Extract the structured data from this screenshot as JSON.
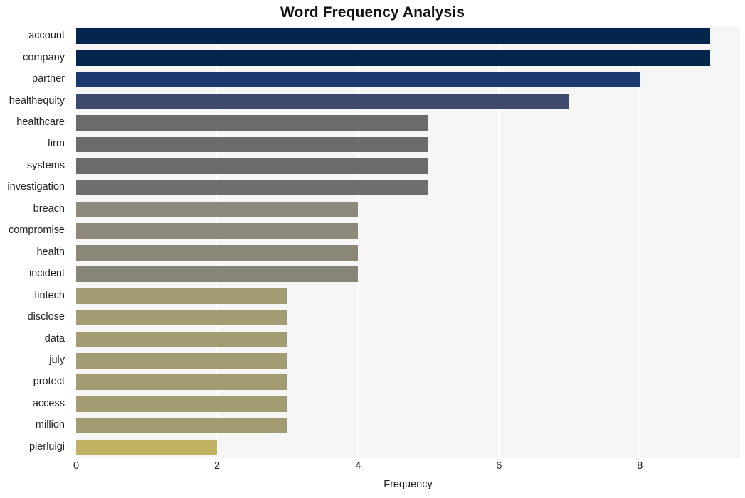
{
  "chart_data": {
    "type": "bar",
    "orientation": "horizontal",
    "title": "Word Frequency Analysis",
    "xlabel": "Frequency",
    "ylabel": "",
    "categories": [
      "account",
      "company",
      "partner",
      "healthequity",
      "healthcare",
      "firm",
      "systems",
      "investigation",
      "breach",
      "compromise",
      "health",
      "incident",
      "fintech",
      "disclose",
      "data",
      "july",
      "protect",
      "access",
      "million",
      "pierluigi"
    ],
    "values": [
      9,
      9,
      8,
      7,
      5,
      5,
      5,
      5,
      4,
      4,
      4,
      4,
      3,
      3,
      3,
      3,
      3,
      3,
      3,
      2
    ],
    "bar_colors": [
      "#04264d",
      "#04264d",
      "#1a3a70",
      "#3e4b6e",
      "#6b6b6e",
      "#6b6b6e",
      "#6b6b6e",
      "#6f6f72",
      "#8d8a7c",
      "#8d8a7c",
      "#8b8878",
      "#87857a",
      "#a39b72",
      "#a39b72",
      "#a39b72",
      "#a39b72",
      "#a39b72",
      "#a39b72",
      "#a39b72",
      "#c2b263"
    ],
    "xticks": [
      0,
      2,
      4,
      6,
      8
    ],
    "xtick_labels": [
      "0",
      "2",
      "4",
      "6",
      "8"
    ],
    "xlim": [
      0,
      9.42
    ],
    "grid": true,
    "grid_color": "#ffffff",
    "plot_background": "#f6f6f7",
    "figure_background": "#ffffff",
    "legend": "none"
  }
}
